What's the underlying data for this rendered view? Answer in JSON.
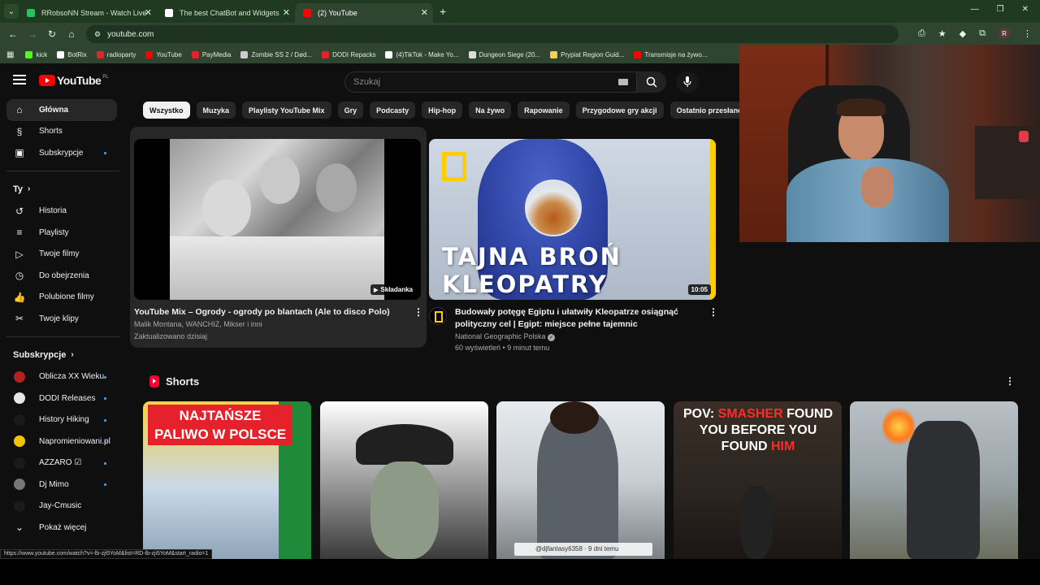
{
  "browser": {
    "tabs": [
      {
        "title": "RRobsoNN Stream - Watch Live",
        "color": "#22c55e"
      },
      {
        "title": "The best ChatBot and Widgets",
        "color": "#ffffff"
      },
      {
        "title": "(2) YouTube",
        "color": "#ff0000"
      }
    ],
    "url": "youtube.com",
    "avatar_letter": "R",
    "bookmarks": [
      {
        "label": "kick",
        "color": "#53fc18"
      },
      {
        "label": "BotRix",
        "color": "#ffffff"
      },
      {
        "label": "radioparty",
        "color": "#e5222c"
      },
      {
        "label": "YouTube",
        "color": "#ff0000"
      },
      {
        "label": "PayMedia",
        "color": "#e5222c"
      },
      {
        "label": "Zombie SS 2 / Død...",
        "color": "#cccccc"
      },
      {
        "label": "DODI Repacks",
        "color": "#e5222c"
      },
      {
        "label": "(4)TikTok - Make Yo...",
        "color": "#ffffff"
      },
      {
        "label": "Dungeon Siege (20...",
        "color": "#dddddd"
      },
      {
        "label": "Prypiat Region Guid...",
        "color": "#f5d24a"
      },
      {
        "label": "Transmisje na żywo...",
        "color": "#ff0000"
      }
    ],
    "status_url": "https://www.youtube.com/watch?v=-lb-zji5YoM&list=RD-lb-zji5YoM&start_radio=1"
  },
  "header": {
    "logo_text": "YouTube",
    "region": "PL",
    "search_placeholder": "Szukaj"
  },
  "sidebar": {
    "main": [
      {
        "label": "Główna",
        "icon": "home-icon"
      },
      {
        "label": "Shorts",
        "icon": "shorts-icon"
      },
      {
        "label": "Subskrypcje",
        "icon": "subscriptions-icon"
      }
    ],
    "you_heading": "Ty",
    "you": [
      {
        "label": "Historia",
        "icon": "history-icon"
      },
      {
        "label": "Playlisty",
        "icon": "playlist-icon"
      },
      {
        "label": "Twoje filmy",
        "icon": "video-icon"
      },
      {
        "label": "Do obejrzenia",
        "icon": "clock-icon"
      },
      {
        "label": "Polubione filmy",
        "icon": "thumbs-up-icon"
      },
      {
        "label": "Twoje klipy",
        "icon": "scissors-icon"
      }
    ],
    "subs_heading": "Subskrypcje",
    "subs": [
      {
        "label": "Oblicza XX Wieku",
        "color": "#b32020"
      },
      {
        "label": "DODI Releases",
        "color": "#e6e6e6"
      },
      {
        "label": "History Hiking",
        "color": "#1a1a1a"
      },
      {
        "label": "Napromieniowani.pl",
        "color": "#f5c400"
      },
      {
        "label": "AZZARO ☑",
        "color": "#1a1a1a"
      },
      {
        "label": "Dj Mimo",
        "color": "#777777"
      },
      {
        "label": "Jay-Cmusic",
        "color": "#1a1a1a"
      }
    ],
    "show_more": "Pokaż więcej"
  },
  "chips": [
    "Wszystko",
    "Muzyka",
    "Playlisty YouTube Mix",
    "Gry",
    "Podcasty",
    "Hip-hop",
    "Na żywo",
    "Rapowanie",
    "Przygodowe gry akcji",
    "Ostatnio przesłane"
  ],
  "videos": [
    {
      "title": "YouTube Mix – Ogrody - ogrody po blantach (Ale to disco Polo)",
      "channel": "Malik Montana, WANCHIZ, Mikser i inni",
      "meta": "Zaktualizowano dzisiaj",
      "badge": "Składanka"
    },
    {
      "title": "Budowały potęgę Egiptu i ułatwiły Kleopatrze osiągnąć polityczny cel | Egipt: miejsce pełne tajemnic",
      "channel": "National Geographic Polska",
      "meta": "60 wyświetleń • 9 minut temu",
      "badge": "10:05",
      "thumb_text_1": "TAJNA BROŃ",
      "thumb_text_2": "KLEOPATRY"
    }
  ],
  "shorts": {
    "heading": "Shorts",
    "s1_line1": "NAJTAŃSZE",
    "s1_line2": "PALIWO W POLSCE",
    "s3_caption": "@djfantasy6358 · 9 dni temu",
    "s4_prefix": "POV: ",
    "s4_red1": "SMASHER",
    "s4_mid": " FOUND YOU BEFORE YOU FOUND ",
    "s4_red2": "HIM"
  }
}
